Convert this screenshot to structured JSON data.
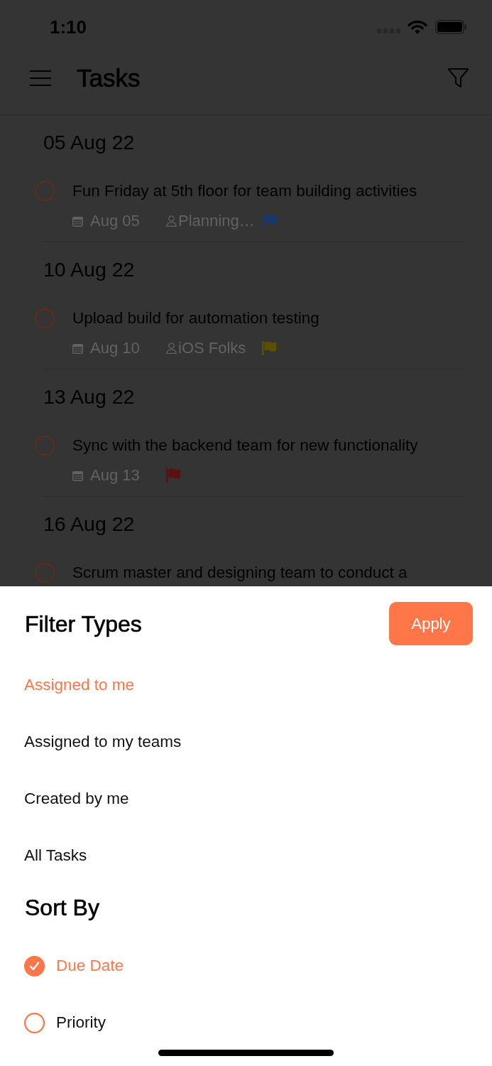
{
  "status_bar": {
    "time": "1:10"
  },
  "nav_bar": {
    "title": "Tasks"
  },
  "task_groups": [
    {
      "date": "05 Aug 22",
      "tasks": [
        {
          "title": "Fun Friday at 5th floor for team building activities",
          "checked": false,
          "due": "Aug 05",
          "assignee": "Planning…",
          "color": "#16386a"
        }
      ]
    },
    {
      "date": "10 Aug 22",
      "tasks": [
        {
          "title": "Upload build for automation testing",
          "checked": false,
          "due": "Aug 10",
          "assignee": "iOS Folks",
          "color": "#5a5000"
        }
      ]
    },
    {
      "date": "13 Aug 22",
      "tasks": [
        {
          "title": "Sync with the backend team for new functionality",
          "checked": false,
          "due": "Aug 13",
          "color": "#5c1010"
        }
      ]
    },
    {
      "date": "16 Aug 22",
      "tasks": [
        {
          "title": "Scrum master and designing team to conduct a",
          "checked": false
        }
      ]
    }
  ],
  "filter_sheet": {
    "title": "Filter Types",
    "apply_button": "Apply",
    "filter_options": [
      {
        "label": "Assigned to me",
        "selected": true
      },
      {
        "label": "Assigned to my teams",
        "selected": false
      },
      {
        "label": "Created by me",
        "selected": false
      },
      {
        "label": "All Tasks",
        "selected": false
      }
    ],
    "sort_title": "Sort By",
    "sort_options": [
      {
        "label": "Due Date",
        "selected": true
      },
      {
        "label": "Priority",
        "selected": false
      }
    ]
  }
}
